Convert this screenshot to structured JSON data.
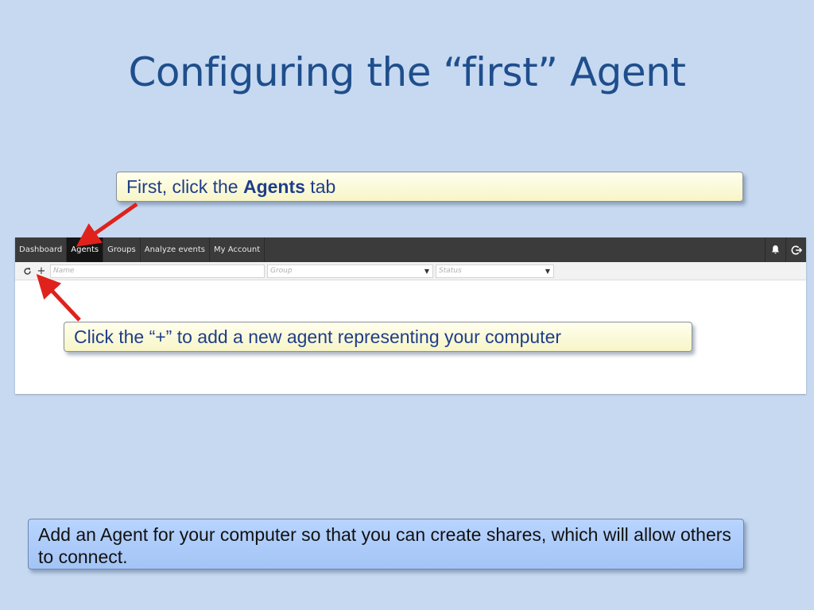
{
  "slide": {
    "title": "Configuring the “first” Agent"
  },
  "callouts": {
    "first": {
      "prefix": "First, click the ",
      "bold": "Agents",
      "suffix": " tab"
    },
    "second": {
      "text": "Click the “+” to add a new agent representing your computer"
    },
    "note": {
      "text": "Add an Agent for your computer so that you can create shares, which will allow others to connect."
    }
  },
  "app": {
    "nav": {
      "tabs": [
        {
          "label": "Dashboard",
          "active": false
        },
        {
          "label": "Agents",
          "active": true
        },
        {
          "label": "Groups",
          "active": false
        },
        {
          "label": "Analyze events",
          "active": false
        },
        {
          "label": "My Account",
          "active": false
        }
      ],
      "icons": [
        "bell-icon",
        "logout-icon"
      ]
    },
    "toolbar": {
      "refresh_icon": "refresh-icon",
      "add_label": "+",
      "name_placeholder": "Name",
      "group_placeholder": "Group",
      "status_placeholder": "Status"
    }
  },
  "colors": {
    "background": "#c6d9f1",
    "title": "#1f4e8c",
    "arrow": "#e0221c",
    "navbar": "#3b3b3b",
    "active_tab": "#151515"
  }
}
